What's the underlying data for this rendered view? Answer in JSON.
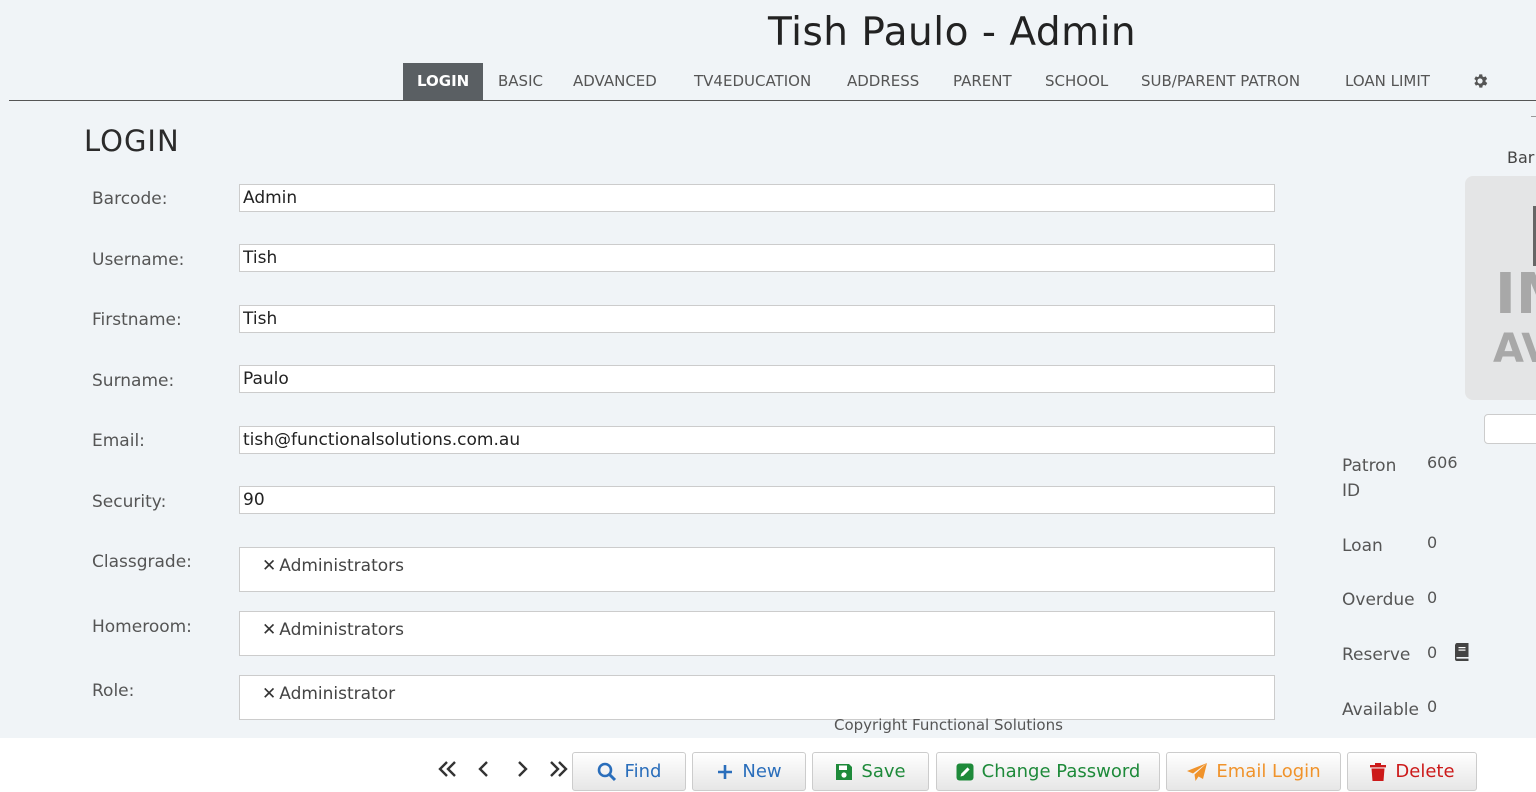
{
  "header": {
    "title": "Tish Paulo - Admin"
  },
  "tabs": [
    {
      "label": "LOGIN",
      "active": true
    },
    {
      "label": "BASIC"
    },
    {
      "label": "ADVANCED"
    },
    {
      "label": "TV4EDUCATION"
    },
    {
      "label": "ADDRESS"
    },
    {
      "label": "PARENT"
    },
    {
      "label": "SCHOOL"
    },
    {
      "label": "SUB/PARENT PATRON"
    },
    {
      "label": "LOAN LIMIT"
    }
  ],
  "settings_icon": "gear-icon",
  "section": {
    "title": "LOGIN"
  },
  "fields": {
    "barcode": {
      "label": "Barcode:",
      "value": "Admin"
    },
    "username": {
      "label": "Username:",
      "value": "Tish"
    },
    "firstname": {
      "label": "Firstname:",
      "value": "Tish"
    },
    "surname": {
      "label": "Surname:",
      "value": "Paulo"
    },
    "email": {
      "label": "Email:",
      "value": "tish@functionalsolutions.com.au"
    },
    "security": {
      "label": "Security:",
      "value": "90"
    },
    "classgrade": {
      "label": "Classgrade:",
      "tag": "Administrators"
    },
    "homeroom": {
      "label": "Homeroom:",
      "tag": "Administrators"
    },
    "role": {
      "label": "Role:",
      "tag": "Administrator"
    }
  },
  "tag_remove_glyph": "✕",
  "stats": {
    "patron_id": {
      "label_line1": "Patron",
      "label_line2": "ID",
      "value": "606"
    },
    "loan": {
      "label": "Loan",
      "value": "0"
    },
    "overdue": {
      "label": "Overdue",
      "value": "0"
    },
    "reserve": {
      "label": "Reserve",
      "value": "0",
      "icon": "book-icon"
    },
    "available": {
      "label": "Available",
      "value": "0"
    }
  },
  "side_panel": {
    "barcode_label": "Bar",
    "image_text_line1": "IM",
    "image_text_line2": "AV"
  },
  "footer": {
    "copyright": "Copyright Functional Solutions",
    "buttons": {
      "find": "Find",
      "new": "New",
      "save": "Save",
      "change_password": "Change Password",
      "email_login": "Email Login",
      "delete": "Delete"
    }
  },
  "colors": {
    "find": "#2a6ebb",
    "new": "#2a6ebb",
    "save": "#1e8a3a",
    "change_password": "#1e8a3a",
    "email_login": "#f0932b",
    "delete": "#cc1a1a",
    "active_tab": "#5a5f63"
  }
}
